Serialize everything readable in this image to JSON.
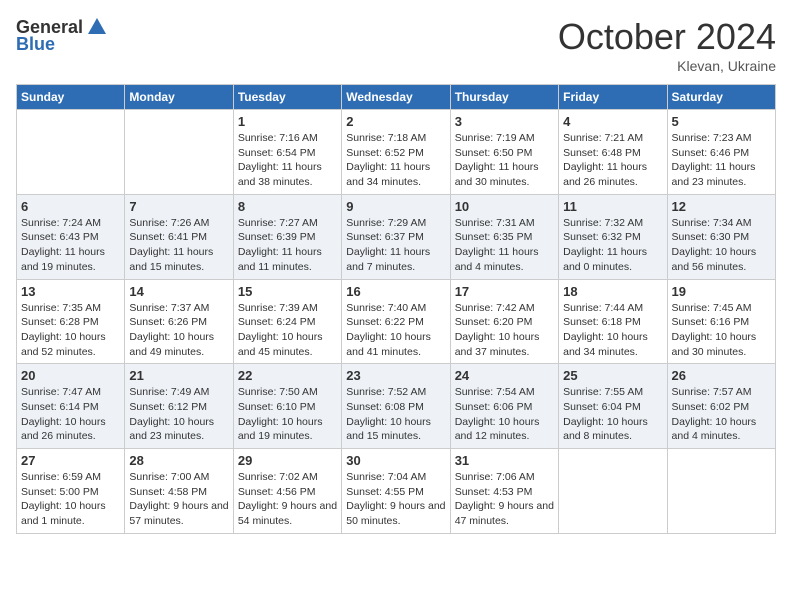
{
  "header": {
    "logo_general": "General",
    "logo_blue": "Blue",
    "month_title": "October 2024",
    "location": "Klevan, Ukraine"
  },
  "weekdays": [
    "Sunday",
    "Monday",
    "Tuesday",
    "Wednesday",
    "Thursday",
    "Friday",
    "Saturday"
  ],
  "weeks": [
    [
      {
        "day": "",
        "info": ""
      },
      {
        "day": "",
        "info": ""
      },
      {
        "day": "1",
        "info": "Sunrise: 7:16 AM\nSunset: 6:54 PM\nDaylight: 11 hours and 38 minutes."
      },
      {
        "day": "2",
        "info": "Sunrise: 7:18 AM\nSunset: 6:52 PM\nDaylight: 11 hours and 34 minutes."
      },
      {
        "day": "3",
        "info": "Sunrise: 7:19 AM\nSunset: 6:50 PM\nDaylight: 11 hours and 30 minutes."
      },
      {
        "day": "4",
        "info": "Sunrise: 7:21 AM\nSunset: 6:48 PM\nDaylight: 11 hours and 26 minutes."
      },
      {
        "day": "5",
        "info": "Sunrise: 7:23 AM\nSunset: 6:46 PM\nDaylight: 11 hours and 23 minutes."
      }
    ],
    [
      {
        "day": "6",
        "info": "Sunrise: 7:24 AM\nSunset: 6:43 PM\nDaylight: 11 hours and 19 minutes."
      },
      {
        "day": "7",
        "info": "Sunrise: 7:26 AM\nSunset: 6:41 PM\nDaylight: 11 hours and 15 minutes."
      },
      {
        "day": "8",
        "info": "Sunrise: 7:27 AM\nSunset: 6:39 PM\nDaylight: 11 hours and 11 minutes."
      },
      {
        "day": "9",
        "info": "Sunrise: 7:29 AM\nSunset: 6:37 PM\nDaylight: 11 hours and 7 minutes."
      },
      {
        "day": "10",
        "info": "Sunrise: 7:31 AM\nSunset: 6:35 PM\nDaylight: 11 hours and 4 minutes."
      },
      {
        "day": "11",
        "info": "Sunrise: 7:32 AM\nSunset: 6:32 PM\nDaylight: 11 hours and 0 minutes."
      },
      {
        "day": "12",
        "info": "Sunrise: 7:34 AM\nSunset: 6:30 PM\nDaylight: 10 hours and 56 minutes."
      }
    ],
    [
      {
        "day": "13",
        "info": "Sunrise: 7:35 AM\nSunset: 6:28 PM\nDaylight: 10 hours and 52 minutes."
      },
      {
        "day": "14",
        "info": "Sunrise: 7:37 AM\nSunset: 6:26 PM\nDaylight: 10 hours and 49 minutes."
      },
      {
        "day": "15",
        "info": "Sunrise: 7:39 AM\nSunset: 6:24 PM\nDaylight: 10 hours and 45 minutes."
      },
      {
        "day": "16",
        "info": "Sunrise: 7:40 AM\nSunset: 6:22 PM\nDaylight: 10 hours and 41 minutes."
      },
      {
        "day": "17",
        "info": "Sunrise: 7:42 AM\nSunset: 6:20 PM\nDaylight: 10 hours and 37 minutes."
      },
      {
        "day": "18",
        "info": "Sunrise: 7:44 AM\nSunset: 6:18 PM\nDaylight: 10 hours and 34 minutes."
      },
      {
        "day": "19",
        "info": "Sunrise: 7:45 AM\nSunset: 6:16 PM\nDaylight: 10 hours and 30 minutes."
      }
    ],
    [
      {
        "day": "20",
        "info": "Sunrise: 7:47 AM\nSunset: 6:14 PM\nDaylight: 10 hours and 26 minutes."
      },
      {
        "day": "21",
        "info": "Sunrise: 7:49 AM\nSunset: 6:12 PM\nDaylight: 10 hours and 23 minutes."
      },
      {
        "day": "22",
        "info": "Sunrise: 7:50 AM\nSunset: 6:10 PM\nDaylight: 10 hours and 19 minutes."
      },
      {
        "day": "23",
        "info": "Sunrise: 7:52 AM\nSunset: 6:08 PM\nDaylight: 10 hours and 15 minutes."
      },
      {
        "day": "24",
        "info": "Sunrise: 7:54 AM\nSunset: 6:06 PM\nDaylight: 10 hours and 12 minutes."
      },
      {
        "day": "25",
        "info": "Sunrise: 7:55 AM\nSunset: 6:04 PM\nDaylight: 10 hours and 8 minutes."
      },
      {
        "day": "26",
        "info": "Sunrise: 7:57 AM\nSunset: 6:02 PM\nDaylight: 10 hours and 4 minutes."
      }
    ],
    [
      {
        "day": "27",
        "info": "Sunrise: 6:59 AM\nSunset: 5:00 PM\nDaylight: 10 hours and 1 minute."
      },
      {
        "day": "28",
        "info": "Sunrise: 7:00 AM\nSunset: 4:58 PM\nDaylight: 9 hours and 57 minutes."
      },
      {
        "day": "29",
        "info": "Sunrise: 7:02 AM\nSunset: 4:56 PM\nDaylight: 9 hours and 54 minutes."
      },
      {
        "day": "30",
        "info": "Sunrise: 7:04 AM\nSunset: 4:55 PM\nDaylight: 9 hours and 50 minutes."
      },
      {
        "day": "31",
        "info": "Sunrise: 7:06 AM\nSunset: 4:53 PM\nDaylight: 9 hours and 47 minutes."
      },
      {
        "day": "",
        "info": ""
      },
      {
        "day": "",
        "info": ""
      }
    ]
  ]
}
